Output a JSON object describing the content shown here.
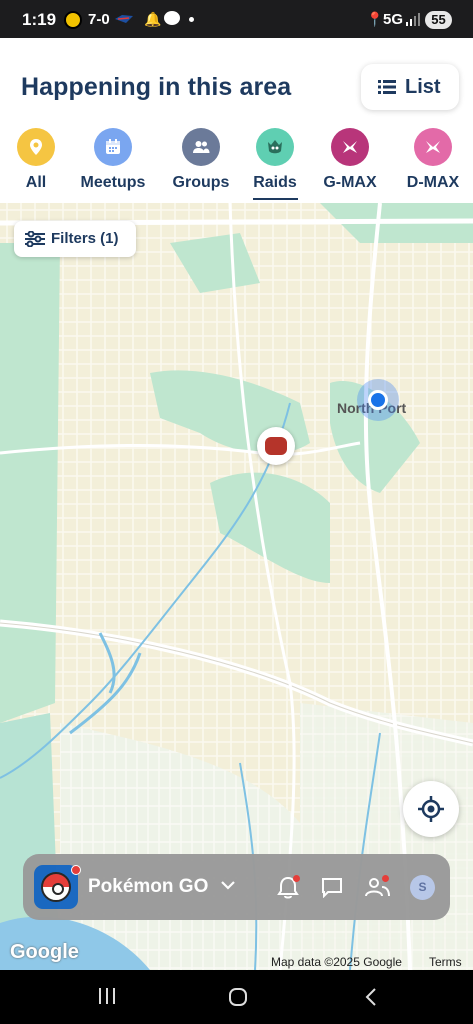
{
  "status_bar": {
    "time": "1:19",
    "score": "7-0",
    "network": "5G",
    "battery": "55"
  },
  "header": {
    "title": "Happening in this area",
    "list_button": "List"
  },
  "tabs": [
    {
      "label": "All",
      "color": "#f5c542"
    },
    {
      "label": "Meetups",
      "color": "#7aa6f0"
    },
    {
      "label": "Groups",
      "color": "#6b7a99"
    },
    {
      "label": "Raids",
      "color": "#5fcfb2",
      "selected": true
    },
    {
      "label": "G-MAX",
      "color": "#b8357a"
    },
    {
      "label": "D-MAX",
      "color": "#e36aa8"
    }
  ],
  "map": {
    "filters_label": "Filters (1)",
    "town_label": "North Port",
    "attribution": "Map data ©2025 Google",
    "terms": "Terms",
    "google_logo": "Google"
  },
  "bottom_bar": {
    "app_name": "Pokémon GO",
    "avatar_initial": "S"
  }
}
